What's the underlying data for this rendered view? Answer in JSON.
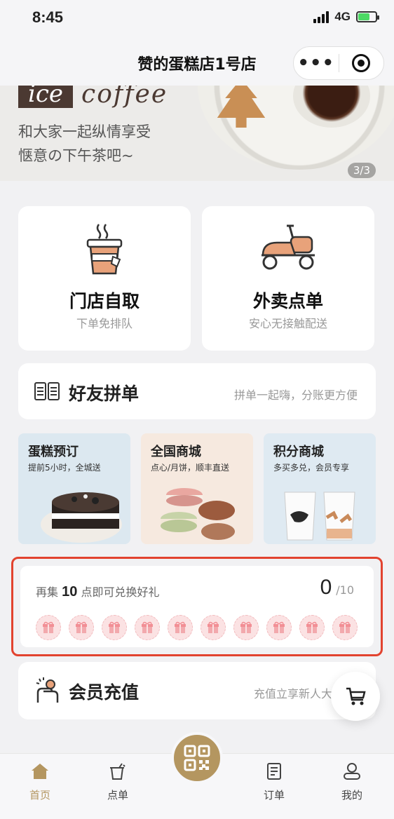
{
  "status_bar": {
    "time": "8:45",
    "network": "4G"
  },
  "navbar": {
    "title": "赞的蛋糕店1号店",
    "more_glyph": "•••"
  },
  "banner": {
    "brand_part1": "ice",
    "brand_part2": "coffee",
    "line1": "和大家一起纵情享受",
    "line2": "惬意の下午茶吧~",
    "pager": "3/3"
  },
  "order_options": [
    {
      "title": "门店自取",
      "subtitle": "下单免排队",
      "icon": "coffee-cup-icon"
    },
    {
      "title": "外卖点单",
      "subtitle": "安心无接触配送",
      "icon": "scooter-icon"
    }
  ],
  "group_order": {
    "label": "好友拼单",
    "desc": "拼单一起嗨，分账更方便",
    "icon": "tickets-icon"
  },
  "categories": [
    {
      "title": "蛋糕预订",
      "subtitle": "提前5小时，全城送",
      "bg": "#dce8f0"
    },
    {
      "title": "全国商城",
      "subtitle": "点心/月饼，顺丰直送",
      "bg": "#f6e9df"
    },
    {
      "title": "积分商城",
      "subtitle": "多买多兑，会员专享",
      "bg": "#dfeaf2"
    }
  ],
  "points": {
    "hint_prefix": "再集",
    "hint_number": "10",
    "hint_suffix": "点即可兑换好礼",
    "current": "0",
    "total": "/10",
    "slots": 10
  },
  "membership": {
    "label": "会员充值",
    "desc": "充值立享新人大",
    "icon": "hand-coins-icon"
  },
  "tabbar": {
    "items": [
      {
        "label": "首页",
        "icon": "home-icon",
        "active": true
      },
      {
        "label": "点单",
        "icon": "cup-icon",
        "active": false
      },
      {
        "label": "订单",
        "icon": "receipt-icon",
        "active": false
      },
      {
        "label": "我的",
        "icon": "profile-icon",
        "active": false
      }
    ],
    "center_icon": "qr-code-icon"
  },
  "colors": {
    "accent": "#b49660",
    "highlight_border": "#e2432f",
    "icon_orange": "#e8a27a"
  }
}
